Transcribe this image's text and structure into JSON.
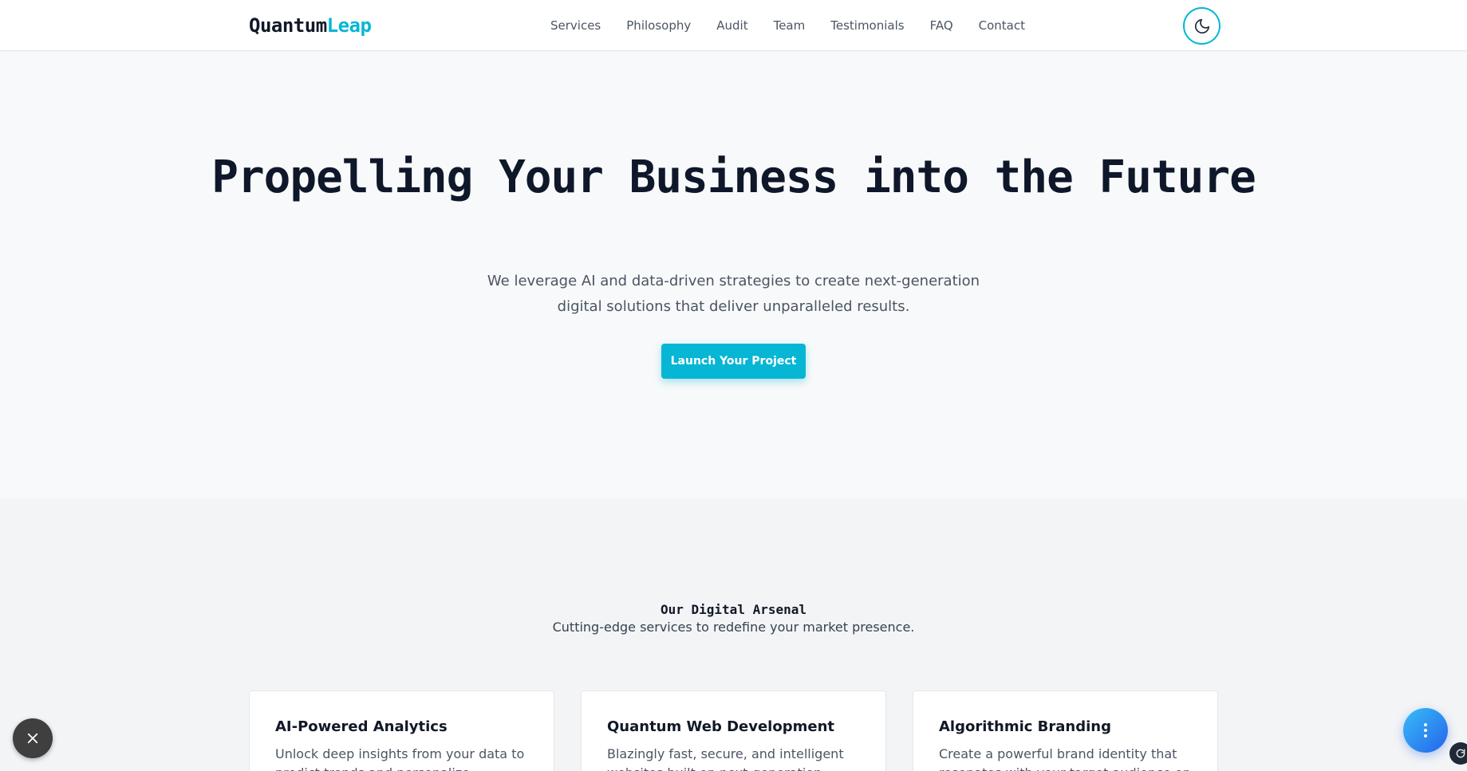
{
  "header": {
    "logo_part1": "Quantum",
    "logo_part2": "Leap",
    "nav": [
      "Services",
      "Philosophy",
      "Audit",
      "Team",
      "Testimonials",
      "FAQ",
      "Contact"
    ],
    "theme_icon": "moon-icon"
  },
  "hero": {
    "title": "Propelling Your Business into the Future",
    "subtitle": "We leverage AI and data-driven strategies to create next-generation digital solutions that deliver unparalleled results.",
    "cta_label": "Launch Your Project"
  },
  "services": {
    "title": "Our Digital Arsenal",
    "subtitle": "Cutting-edge services to redefine your market presence.",
    "cards": [
      {
        "title": "AI-Powered Analytics",
        "desc": "Unlock deep insights from your data to predict trends and personalize"
      },
      {
        "title": "Quantum Web Development",
        "desc": "Blazingly fast, secure, and intelligent websites built on next-generation"
      },
      {
        "title": "Algorithmic Branding",
        "desc": "Create a powerful brand identity that resonates with your target audience on"
      }
    ]
  },
  "floating": {
    "close_icon": "close-icon",
    "menu_icon": "more-vertical-icon"
  },
  "colors": {
    "accent": "#06b6d4",
    "heading": "#0f172a",
    "body_text": "#4b5563"
  }
}
